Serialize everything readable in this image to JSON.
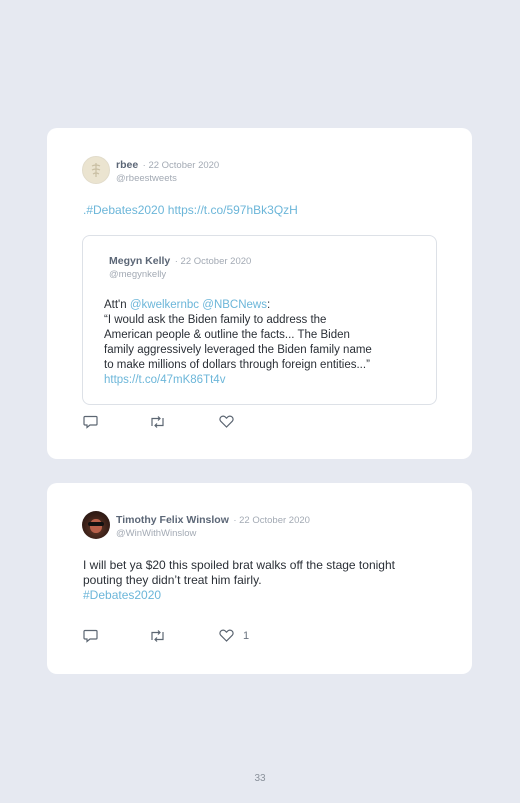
{
  "tweets": [
    {
      "name": "rbee",
      "date": "· 22 October 2020",
      "handle": "@rbeestweets",
      "text_prefix": ".",
      "hashtag": "#Debates2020",
      "link": "https://t.co/597hBk3QzH",
      "quote": {
        "name": "Megyn Kelly",
        "date": "· 22 October 2020",
        "handle": "@megynkelly",
        "attn_prefix": "Att'n",
        "mention1": "@kwelkernbc",
        "mention2": "@NBCNews",
        "colon": ":",
        "line1": "“I would ask the Biden family to address the",
        "line2": "American people & outline the facts... The Biden",
        "line3": "family aggressively leveraged the Biden family name",
        "line4": "to make millions of dollars through foreign entities...”",
        "link": "https://t.co/47mK86Tt4v"
      },
      "like_count": ""
    },
    {
      "name": "Timothy Felix Winslow",
      "date": "· 22 October 2020",
      "handle": "@WinWithWinslow",
      "line1": "I will bet ya $20 this spoiled brat walks off the stage tonight",
      "line2": "pouting they didn’t treat him fairly.",
      "hashtag": "#Debates2020",
      "like_count": "1"
    }
  ],
  "page_number": "33",
  "icons": {
    "reply": "reply-icon",
    "retweet": "retweet-icon",
    "like": "heart-icon"
  },
  "colors": {
    "background": "#e6e9f1",
    "card": "#ffffff",
    "link": "#6cb6d9",
    "muted": "#a3aab4"
  }
}
